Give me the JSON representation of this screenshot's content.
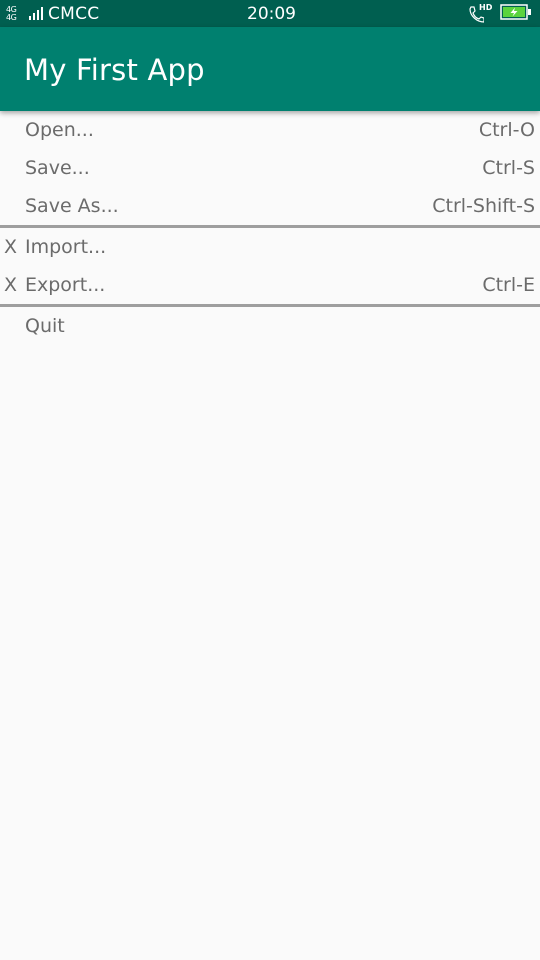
{
  "status_bar": {
    "network_label": "4G 4G",
    "carrier": "CMCC",
    "time": "20:09",
    "hd_label": "HD",
    "icons": [
      "signal-icon",
      "call-hd-icon",
      "battery-charging-icon"
    ],
    "colors": {
      "background": "#005f50",
      "battery": "#5bd33e"
    }
  },
  "app_bar": {
    "title": "My First App",
    "color": "#00806f"
  },
  "menu": {
    "groups": [
      [
        {
          "check": "",
          "label": "Open...",
          "shortcut": "Ctrl-O"
        },
        {
          "check": "",
          "label": "Save...",
          "shortcut": "Ctrl-S"
        },
        {
          "check": "",
          "label": "Save As...",
          "shortcut": "Ctrl-Shift-S"
        }
      ],
      [
        {
          "check": "X",
          "label": "Import...",
          "shortcut": ""
        },
        {
          "check": "X",
          "label": "Export...",
          "shortcut": "Ctrl-E"
        }
      ],
      [
        {
          "check": "",
          "label": "Quit",
          "shortcut": ""
        }
      ]
    ]
  }
}
